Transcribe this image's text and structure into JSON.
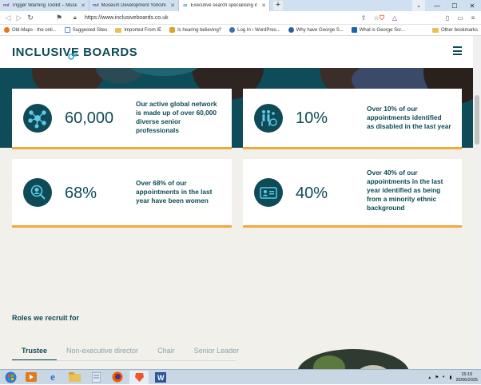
{
  "browser": {
    "tabs": [
      {
        "label": "Trigger Warning Toolkit – Museum De",
        "favicon": "md"
      },
      {
        "label": "Museum Development Yorkshire: Trip",
        "favicon": "md"
      },
      {
        "label": "Executive search specialising in di",
        "favicon": "inclusive-boards-icon",
        "active": true
      }
    ],
    "new_tab": "+",
    "url": "https://www.inclusiveboards.co.uk",
    "bookmarks": [
      {
        "label": "Old-Maps - the onli...",
        "color": "#e8741a"
      },
      {
        "label": "Suggested Sites",
        "color": "#5a8fd6"
      },
      {
        "label": "Imported From IE",
        "color": "#e8c15a"
      },
      {
        "label": "Is hearing believing?",
        "color": "#d9a32a"
      },
      {
        "label": "Log In ‹ WordPres...",
        "color": "#3d6fb8"
      },
      {
        "label": "Why have George S...",
        "color": "#2d5fa0"
      },
      {
        "label": "What is George Scr...",
        "color": "#1f63b5"
      }
    ],
    "other_bookmarks": "Other bookmarks"
  },
  "site": {
    "logo": "INCLUSIVE BOARDS",
    "stats": [
      {
        "value": "60,000",
        "desc_lines": [
          "Our active global network",
          "is made up of over 60,000",
          "diverse senior",
          "professionals"
        ],
        "icon": "network-icon"
      },
      {
        "value": "10%",
        "desc_lines": [
          "Over 10% of our",
          "appointments identified",
          "as disabled in the last year"
        ],
        "icon": "accessibility-icon"
      },
      {
        "value": "68%",
        "desc_lines": [
          "Over 68% of our",
          "appointments in the last",
          "year have been women"
        ],
        "icon": "woman-icon"
      },
      {
        "value": "40%",
        "desc_lines": [
          "Over 40% of our",
          "appointments in the last",
          "year identified as being",
          "from a minority ethnic",
          "background"
        ],
        "icon": "id-card-icon"
      }
    ],
    "roles_title": "Roles we recruit for",
    "role_tabs": [
      "Trustee",
      "Non-executive director",
      "Chair",
      "Senior Leader"
    ],
    "active_role": "Trustee"
  },
  "taskbar": {
    "time": "15:19",
    "date": "20/06/2025"
  },
  "colors": {
    "brand": "#0f4a57",
    "accent": "#f2a93b",
    "page_bg": "#f1f0ea"
  }
}
